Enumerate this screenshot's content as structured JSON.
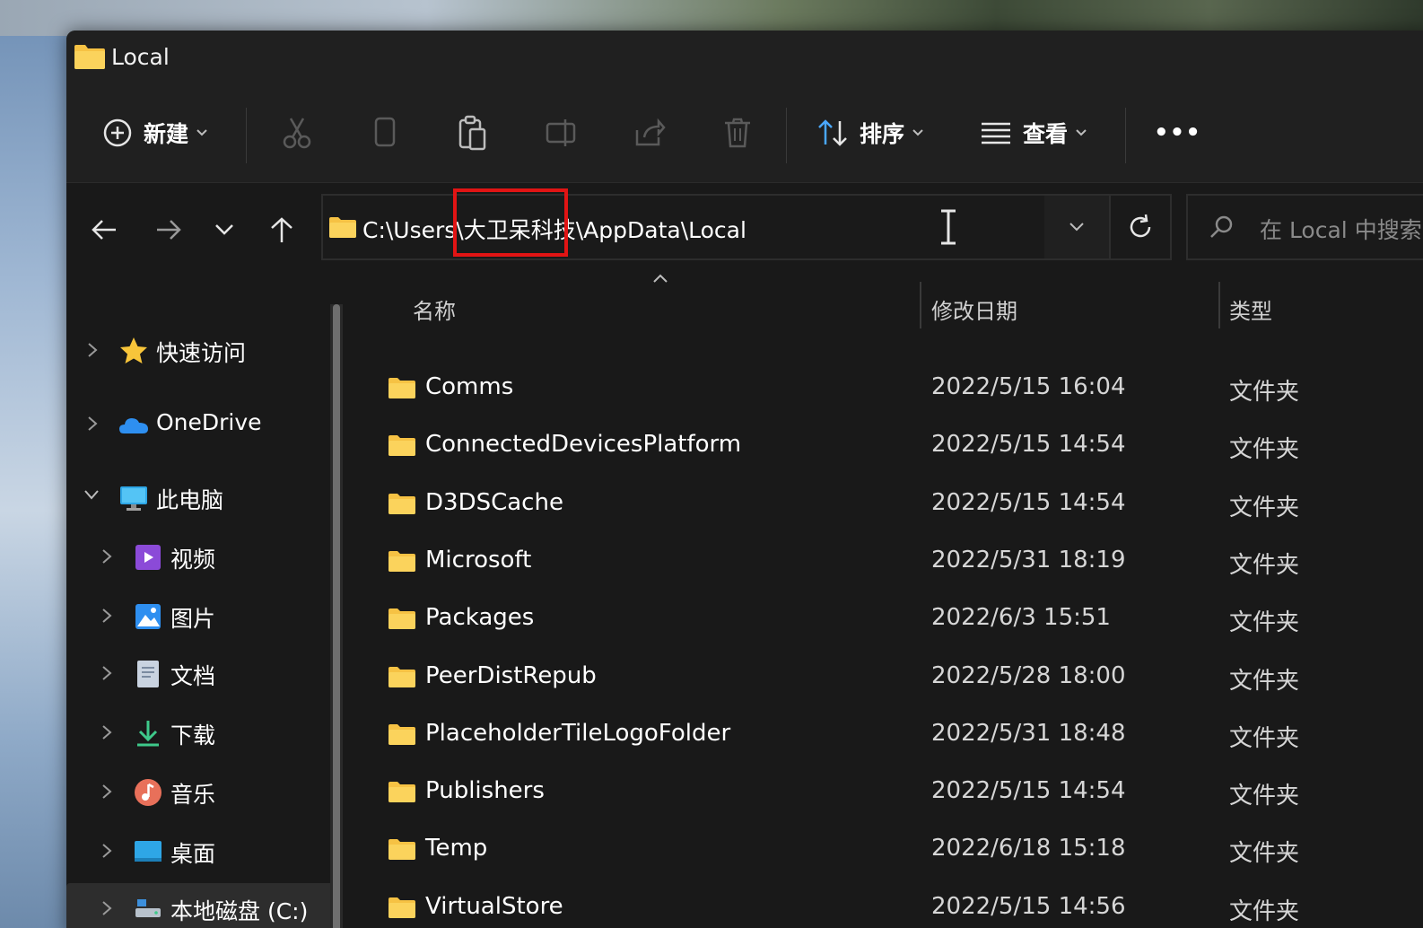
{
  "window": {
    "title": "Local"
  },
  "toolbar": {
    "new_label": "新建",
    "sort_label": "排序",
    "view_label": "查看",
    "more_label": "•••"
  },
  "address": {
    "path_prefix": "C:\\Users\\",
    "path_highlight": "大卫呆科技",
    "path_suffix": "\\AppData\\Local"
  },
  "search": {
    "placeholder": "在 Local 中搜索"
  },
  "sidebar": {
    "items": [
      {
        "label": "快速访问",
        "icon": "star-icon"
      },
      {
        "label": "OneDrive",
        "icon": "cloud-icon"
      },
      {
        "label": "此电脑",
        "icon": "computer-icon"
      },
      {
        "label": "视频",
        "icon": "video-icon"
      },
      {
        "label": "图片",
        "icon": "pictures-icon"
      },
      {
        "label": "文档",
        "icon": "documents-icon"
      },
      {
        "label": "下载",
        "icon": "download-icon"
      },
      {
        "label": "音乐",
        "icon": "music-icon"
      },
      {
        "label": "桌面",
        "icon": "desktop-icon"
      },
      {
        "label": "本地磁盘 (C:)",
        "icon": "drive-icon"
      }
    ]
  },
  "columns": {
    "name": "名称",
    "date": "修改日期",
    "type": "类型"
  },
  "files": [
    {
      "name": "Comms",
      "date": "2022/5/15 16:04",
      "type": "文件夹"
    },
    {
      "name": "ConnectedDevicesPlatform",
      "date": "2022/5/15 14:54",
      "type": "文件夹"
    },
    {
      "name": "D3DSCache",
      "date": "2022/5/15 14:54",
      "type": "文件夹"
    },
    {
      "name": "Microsoft",
      "date": "2022/5/31 18:19",
      "type": "文件夹"
    },
    {
      "name": "Packages",
      "date": "2022/6/3 15:51",
      "type": "文件夹"
    },
    {
      "name": "PeerDistRepub",
      "date": "2022/5/28 18:00",
      "type": "文件夹"
    },
    {
      "name": "PlaceholderTileLogoFolder",
      "date": "2022/5/31 18:48",
      "type": "文件夹"
    },
    {
      "name": "Publishers",
      "date": "2022/5/15 14:54",
      "type": "文件夹"
    },
    {
      "name": "Temp",
      "date": "2022/6/18 15:18",
      "type": "文件夹"
    },
    {
      "name": "VirtualStore",
      "date": "2022/5/15 14:56",
      "type": "文件夹"
    }
  ],
  "colors": {
    "folder": "#f6c244",
    "highlight_box": "#e11414",
    "window_bg": "#1c1c1c"
  }
}
